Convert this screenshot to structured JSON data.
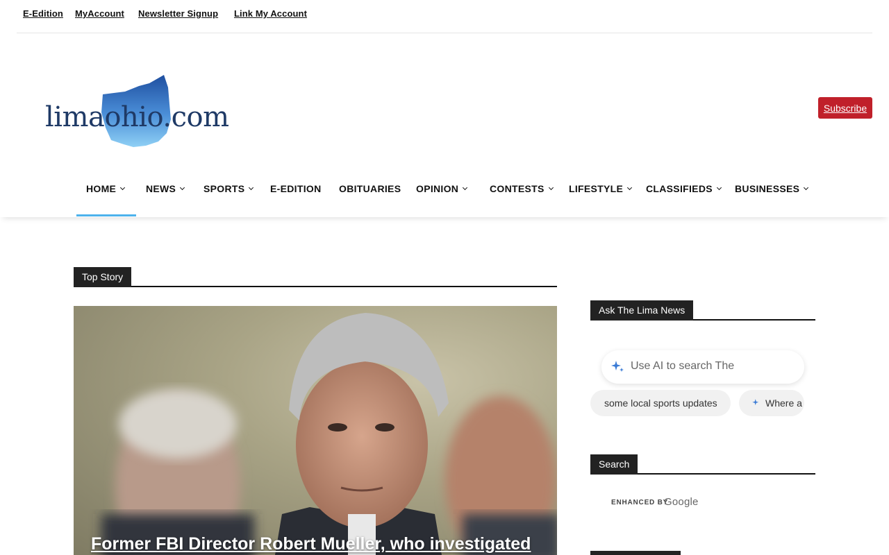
{
  "util_links": [
    "E-Edition",
    "MyAccount",
    "Newsletter Signup",
    "Link My Account"
  ],
  "logo": {
    "text": "limaohio.com"
  },
  "subscribe_label": "Subscribe",
  "nav": {
    "items": [
      {
        "label": "HOME",
        "dropdown": true
      },
      {
        "label": "NEWS",
        "dropdown": true
      },
      {
        "label": "SPORTS",
        "dropdown": true
      },
      {
        "label": "E-EDITION",
        "dropdown": false
      },
      {
        "label": "OBITUARIES",
        "dropdown": false
      },
      {
        "label": "OPINION",
        "dropdown": true
      },
      {
        "label": "CONTESTS",
        "dropdown": true
      },
      {
        "label": "LIFESTYLE",
        "dropdown": true
      },
      {
        "label": "CLASSIFIEDS",
        "dropdown": true
      },
      {
        "label": "BUSINESSES",
        "dropdown": true
      }
    ],
    "active": "HOME"
  },
  "top_story": {
    "section_title": "Top Story",
    "headline": "Former FBI Director Robert Mueller, who investigated"
  },
  "sidebar": {
    "ask_title": "Ask The Lima News",
    "ai_placeholder": "Use AI to search The",
    "suggestions": [
      "some local sports updates",
      "Where a"
    ],
    "search_title": "Search",
    "enhanced_by": "ENHANCED BY",
    "google": "Google"
  },
  "colors": {
    "accent": "#4db2ec",
    "subscribe": "#c0202a",
    "block_bg": "#222222"
  }
}
